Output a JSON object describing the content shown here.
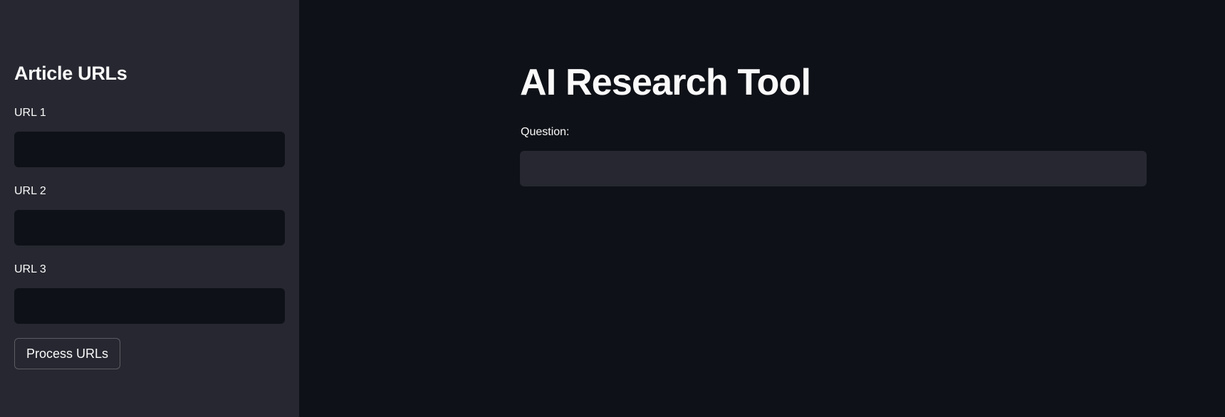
{
  "sidebar": {
    "title": "Article URLs",
    "fields": [
      {
        "label": "URL 1",
        "value": ""
      },
      {
        "label": "URL 2",
        "value": ""
      },
      {
        "label": "URL 3",
        "value": ""
      }
    ],
    "process_button_label": "Process URLs"
  },
  "main": {
    "title": "AI Research Tool",
    "question_label": "Question:",
    "question_value": ""
  },
  "colors": {
    "background": "#0e1117",
    "sidebar_background": "#262730",
    "text": "#fafafa"
  }
}
